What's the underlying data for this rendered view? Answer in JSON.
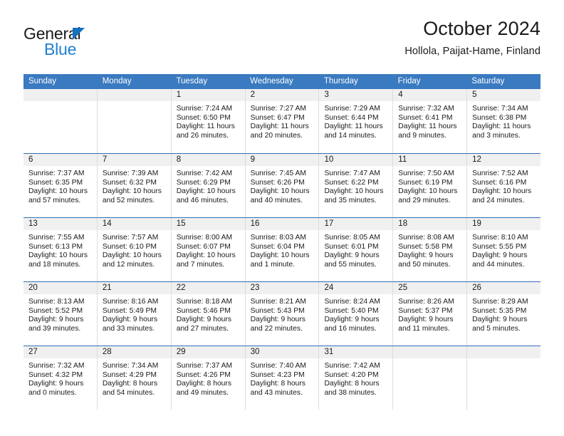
{
  "brand": {
    "name_part1": "General",
    "name_part2": "Blue",
    "triangle_color": "#1570c0",
    "blue_color": "#1f7fd0"
  },
  "header": {
    "title": "October 2024",
    "location": "Hollola, Paijat-Hame, Finland"
  },
  "theme": {
    "header_blue": "#3a7ac0",
    "week_divider_blue": "#2f6fb5",
    "daynum_strip": "#f0f0f0",
    "cell_divider": "#dddddd"
  },
  "weekdays": [
    "Sunday",
    "Monday",
    "Tuesday",
    "Wednesday",
    "Thursday",
    "Friday",
    "Saturday"
  ],
  "weeks": [
    [
      {
        "day": "",
        "sunrise": "",
        "sunset": "",
        "daylight": "",
        "daylight2": ""
      },
      {
        "day": "",
        "sunrise": "",
        "sunset": "",
        "daylight": "",
        "daylight2": ""
      },
      {
        "day": "1",
        "sunrise": "Sunrise: 7:24 AM",
        "sunset": "Sunset: 6:50 PM",
        "daylight": "Daylight: 11 hours",
        "daylight2": "and 26 minutes."
      },
      {
        "day": "2",
        "sunrise": "Sunrise: 7:27 AM",
        "sunset": "Sunset: 6:47 PM",
        "daylight": "Daylight: 11 hours",
        "daylight2": "and 20 minutes."
      },
      {
        "day": "3",
        "sunrise": "Sunrise: 7:29 AM",
        "sunset": "Sunset: 6:44 PM",
        "daylight": "Daylight: 11 hours",
        "daylight2": "and 14 minutes."
      },
      {
        "day": "4",
        "sunrise": "Sunrise: 7:32 AM",
        "sunset": "Sunset: 6:41 PM",
        "daylight": "Daylight: 11 hours",
        "daylight2": "and 9 minutes."
      },
      {
        "day": "5",
        "sunrise": "Sunrise: 7:34 AM",
        "sunset": "Sunset: 6:38 PM",
        "daylight": "Daylight: 11 hours",
        "daylight2": "and 3 minutes."
      }
    ],
    [
      {
        "day": "6",
        "sunrise": "Sunrise: 7:37 AM",
        "sunset": "Sunset: 6:35 PM",
        "daylight": "Daylight: 10 hours",
        "daylight2": "and 57 minutes."
      },
      {
        "day": "7",
        "sunrise": "Sunrise: 7:39 AM",
        "sunset": "Sunset: 6:32 PM",
        "daylight": "Daylight: 10 hours",
        "daylight2": "and 52 minutes."
      },
      {
        "day": "8",
        "sunrise": "Sunrise: 7:42 AM",
        "sunset": "Sunset: 6:29 PM",
        "daylight": "Daylight: 10 hours",
        "daylight2": "and 46 minutes."
      },
      {
        "day": "9",
        "sunrise": "Sunrise: 7:45 AM",
        "sunset": "Sunset: 6:26 PM",
        "daylight": "Daylight: 10 hours",
        "daylight2": "and 40 minutes."
      },
      {
        "day": "10",
        "sunrise": "Sunrise: 7:47 AM",
        "sunset": "Sunset: 6:22 PM",
        "daylight": "Daylight: 10 hours",
        "daylight2": "and 35 minutes."
      },
      {
        "day": "11",
        "sunrise": "Sunrise: 7:50 AM",
        "sunset": "Sunset: 6:19 PM",
        "daylight": "Daylight: 10 hours",
        "daylight2": "and 29 minutes."
      },
      {
        "day": "12",
        "sunrise": "Sunrise: 7:52 AM",
        "sunset": "Sunset: 6:16 PM",
        "daylight": "Daylight: 10 hours",
        "daylight2": "and 24 minutes."
      }
    ],
    [
      {
        "day": "13",
        "sunrise": "Sunrise: 7:55 AM",
        "sunset": "Sunset: 6:13 PM",
        "daylight": "Daylight: 10 hours",
        "daylight2": "and 18 minutes."
      },
      {
        "day": "14",
        "sunrise": "Sunrise: 7:57 AM",
        "sunset": "Sunset: 6:10 PM",
        "daylight": "Daylight: 10 hours",
        "daylight2": "and 12 minutes."
      },
      {
        "day": "15",
        "sunrise": "Sunrise: 8:00 AM",
        "sunset": "Sunset: 6:07 PM",
        "daylight": "Daylight: 10 hours",
        "daylight2": "and 7 minutes."
      },
      {
        "day": "16",
        "sunrise": "Sunrise: 8:03 AM",
        "sunset": "Sunset: 6:04 PM",
        "daylight": "Daylight: 10 hours",
        "daylight2": "and 1 minute."
      },
      {
        "day": "17",
        "sunrise": "Sunrise: 8:05 AM",
        "sunset": "Sunset: 6:01 PM",
        "daylight": "Daylight: 9 hours",
        "daylight2": "and 55 minutes."
      },
      {
        "day": "18",
        "sunrise": "Sunrise: 8:08 AM",
        "sunset": "Sunset: 5:58 PM",
        "daylight": "Daylight: 9 hours",
        "daylight2": "and 50 minutes."
      },
      {
        "day": "19",
        "sunrise": "Sunrise: 8:10 AM",
        "sunset": "Sunset: 5:55 PM",
        "daylight": "Daylight: 9 hours",
        "daylight2": "and 44 minutes."
      }
    ],
    [
      {
        "day": "20",
        "sunrise": "Sunrise: 8:13 AM",
        "sunset": "Sunset: 5:52 PM",
        "daylight": "Daylight: 9 hours",
        "daylight2": "and 39 minutes."
      },
      {
        "day": "21",
        "sunrise": "Sunrise: 8:16 AM",
        "sunset": "Sunset: 5:49 PM",
        "daylight": "Daylight: 9 hours",
        "daylight2": "and 33 minutes."
      },
      {
        "day": "22",
        "sunrise": "Sunrise: 8:18 AM",
        "sunset": "Sunset: 5:46 PM",
        "daylight": "Daylight: 9 hours",
        "daylight2": "and 27 minutes."
      },
      {
        "day": "23",
        "sunrise": "Sunrise: 8:21 AM",
        "sunset": "Sunset: 5:43 PM",
        "daylight": "Daylight: 9 hours",
        "daylight2": "and 22 minutes."
      },
      {
        "day": "24",
        "sunrise": "Sunrise: 8:24 AM",
        "sunset": "Sunset: 5:40 PM",
        "daylight": "Daylight: 9 hours",
        "daylight2": "and 16 minutes."
      },
      {
        "day": "25",
        "sunrise": "Sunrise: 8:26 AM",
        "sunset": "Sunset: 5:37 PM",
        "daylight": "Daylight: 9 hours",
        "daylight2": "and 11 minutes."
      },
      {
        "day": "26",
        "sunrise": "Sunrise: 8:29 AM",
        "sunset": "Sunset: 5:35 PM",
        "daylight": "Daylight: 9 hours",
        "daylight2": "and 5 minutes."
      }
    ],
    [
      {
        "day": "27",
        "sunrise": "Sunrise: 7:32 AM",
        "sunset": "Sunset: 4:32 PM",
        "daylight": "Daylight: 9 hours",
        "daylight2": "and 0 minutes."
      },
      {
        "day": "28",
        "sunrise": "Sunrise: 7:34 AM",
        "sunset": "Sunset: 4:29 PM",
        "daylight": "Daylight: 8 hours",
        "daylight2": "and 54 minutes."
      },
      {
        "day": "29",
        "sunrise": "Sunrise: 7:37 AM",
        "sunset": "Sunset: 4:26 PM",
        "daylight": "Daylight: 8 hours",
        "daylight2": "and 49 minutes."
      },
      {
        "day": "30",
        "sunrise": "Sunrise: 7:40 AM",
        "sunset": "Sunset: 4:23 PM",
        "daylight": "Daylight: 8 hours",
        "daylight2": "and 43 minutes."
      },
      {
        "day": "31",
        "sunrise": "Sunrise: 7:42 AM",
        "sunset": "Sunset: 4:20 PM",
        "daylight": "Daylight: 8 hours",
        "daylight2": "and 38 minutes."
      },
      {
        "day": "",
        "sunrise": "",
        "sunset": "",
        "daylight": "",
        "daylight2": ""
      },
      {
        "day": "",
        "sunrise": "",
        "sunset": "",
        "daylight": "",
        "daylight2": ""
      }
    ]
  ]
}
